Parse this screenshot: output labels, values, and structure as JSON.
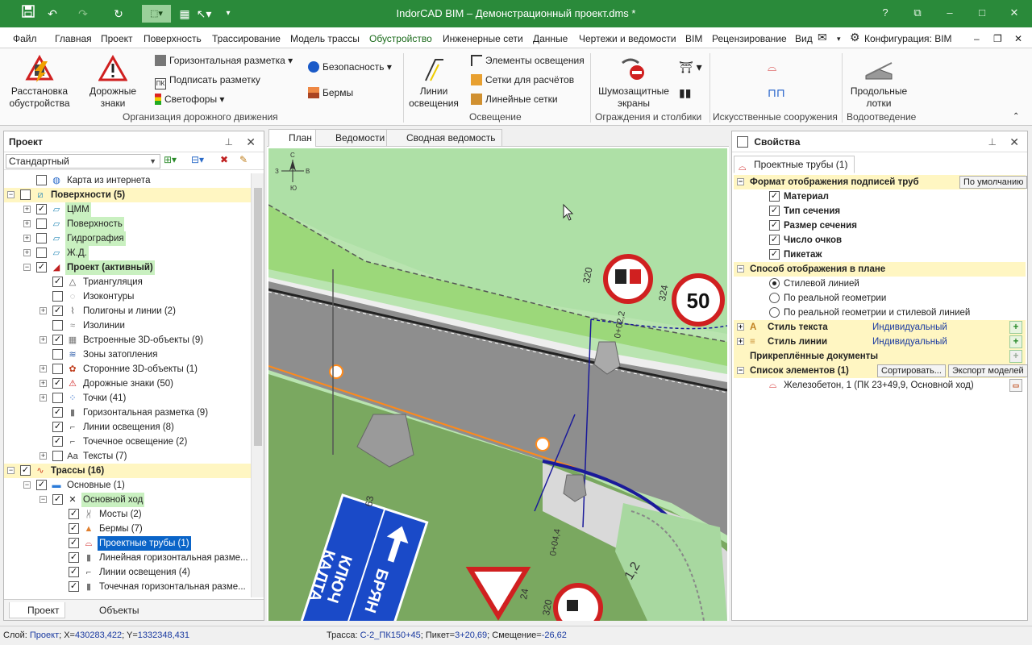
{
  "window": {
    "title": "IndorCAD BIM – Демонстрационный проект.dms *"
  },
  "menu": {
    "items": [
      "Файл",
      "Главная",
      "Проект",
      "Поверхность",
      "Трассирование",
      "Модель трассы",
      "Обустройство",
      "Инженерные сети",
      "Данные",
      "Чертежи и ведомости",
      "BIM",
      "Рецензирование",
      "Вид"
    ],
    "active": "Обустройство",
    "config_label": "Конфигурация: BIM"
  },
  "ribbon": {
    "placement_label": "Расстановка обустройства",
    "road_signs_label": "Дорожные знаки",
    "horizontal_marking": "Горизонтальная разметка",
    "sign_marking": "Подписать разметку",
    "traffic_lights": "Светофоры",
    "safety": "Безопасность",
    "berms": "Бермы",
    "group_traffic": "Организация дорожного движения",
    "lighting_lines": "Линии освещения",
    "lighting_elements": "Элементы освещения",
    "calc_grids": "Сетки для расчётов",
    "linear_grids": "Линейные сетки",
    "group_lighting": "Освещение",
    "noise_screens": "Шумозащитные экраны",
    "group_fences": "Ограждения и столбики",
    "group_structures": "Искусственные сооружения",
    "longitudinal_trays": "Продольные лотки",
    "group_drainage": "Водоотведение"
  },
  "left_panel": {
    "title": "Проект",
    "filter_value": "Стандартный",
    "tree": [
      {
        "label": "Карта из интернета",
        "level": 1,
        "check": "off",
        "tog": "",
        "icon": "globe-icon",
        "style": ""
      },
      {
        "label": "Поверхности (5)",
        "level": 0,
        "check": "off",
        "tog": "-",
        "icon": "surfaces-icon",
        "style": "bold yellow"
      },
      {
        "label": "ЦММ",
        "level": 1,
        "check": "on",
        "tog": "+",
        "icon": "surface-icon",
        "style": "green"
      },
      {
        "label": "Поверхность",
        "level": 1,
        "check": "off",
        "tog": "+",
        "icon": "surface-icon",
        "style": "green"
      },
      {
        "label": "Гидрография",
        "level": 1,
        "check": "off",
        "tog": "+",
        "icon": "surface-icon",
        "style": "green"
      },
      {
        "label": "Ж.Д.",
        "level": 1,
        "check": "off",
        "tog": "+",
        "icon": "surface-icon",
        "style": "green"
      },
      {
        "label": "Проект (активный)",
        "level": 1,
        "check": "on",
        "tog": "-",
        "icon": "surface-active-icon",
        "style": "bold green"
      },
      {
        "label": "Триангуляция",
        "level": 2,
        "check": "on",
        "tog": "",
        "icon": "triangulation-icon",
        "style": ""
      },
      {
        "label": "Изоконтуры",
        "level": 2,
        "check": "off",
        "tog": "",
        "icon": "isocontour-icon",
        "style": ""
      },
      {
        "label": "Полигоны и линии (2)",
        "level": 2,
        "check": "on",
        "tog": "+",
        "icon": "polygon-icon",
        "style": ""
      },
      {
        "label": "Изолинии",
        "level": 2,
        "check": "off",
        "tog": "",
        "icon": "isoline-icon",
        "style": ""
      },
      {
        "label": "Встроенные 3D-объекты (9)",
        "level": 2,
        "check": "on",
        "tog": "+",
        "icon": "object3d-icon",
        "style": ""
      },
      {
        "label": "Зоны затопления",
        "level": 2,
        "check": "off",
        "tog": "",
        "icon": "flood-icon",
        "style": ""
      },
      {
        "label": "Сторонние 3D-объекты (1)",
        "level": 2,
        "check": "off",
        "tog": "+",
        "icon": "external3d-icon",
        "style": ""
      },
      {
        "label": "Дорожные знаки (50)",
        "level": 2,
        "check": "on",
        "tog": "+",
        "icon": "road-sign-icon",
        "style": ""
      },
      {
        "label": "Точки (41)",
        "level": 2,
        "check": "off",
        "tog": "+",
        "icon": "points-icon",
        "style": ""
      },
      {
        "label": "Горизонтальная разметка (9)",
        "level": 2,
        "check": "on",
        "tog": "",
        "icon": "marking-icon",
        "style": ""
      },
      {
        "label": "Линии освещения (8)",
        "level": 2,
        "check": "on",
        "tog": "",
        "icon": "lighting-icon",
        "style": ""
      },
      {
        "label": "Точечное освещение (2)",
        "level": 2,
        "check": "on",
        "tog": "",
        "icon": "spot-light-icon",
        "style": ""
      },
      {
        "label": "Тексты (7)",
        "level": 2,
        "check": "off",
        "tog": "+",
        "icon": "text-icon",
        "style": ""
      },
      {
        "label": "Трассы (16)",
        "level": 0,
        "check": "on",
        "tog": "-",
        "icon": "routes-icon",
        "style": "bold yellow"
      },
      {
        "label": "Основные (1)",
        "level": 1,
        "check": "on",
        "tog": "-",
        "icon": "folder-icon",
        "style": ""
      },
      {
        "label": "Основной ход",
        "level": 2,
        "check": "on",
        "tog": "-",
        "icon": "main-route-icon",
        "style": "green"
      },
      {
        "label": "Мосты (2)",
        "level": 3,
        "check": "on",
        "tog": "",
        "icon": "bridge-icon",
        "style": ""
      },
      {
        "label": "Бермы (7)",
        "level": 3,
        "check": "on",
        "tog": "",
        "icon": "berm-icon",
        "style": ""
      },
      {
        "label": "Проектные трубы (1)",
        "level": 3,
        "check": "on",
        "tog": "",
        "icon": "pipe-icon",
        "style": "selected"
      },
      {
        "label": "Линейная горизонтальная разме...",
        "level": 3,
        "check": "on",
        "tog": "",
        "icon": "linear-marking-icon",
        "style": ""
      },
      {
        "label": "Линии освещения (4)",
        "level": 3,
        "check": "on",
        "tog": "",
        "icon": "lighting-icon",
        "style": ""
      },
      {
        "label": "Точечная горизонтальная разме...",
        "level": 3,
        "check": "on",
        "tog": "",
        "icon": "point-marking-icon",
        "style": ""
      }
    ],
    "tabs": [
      "Проект",
      "Объекты"
    ]
  },
  "center": {
    "tabs": [
      "План",
      "Ведомости",
      "Сводная ведомость"
    ],
    "compass": {
      "n": "С",
      "s": "Ю",
      "w": "З",
      "e": "В"
    },
    "sign_speed": "50",
    "big_sign_line1": "БРЯН",
    "big_sign_line2": "КЛЮЧ",
    "big_sign_line3": "КАЛТА",
    "pk_labels": [
      "320",
      "324",
      "0+02,2",
      "0+04,4",
      "320",
      "24",
      "63",
      "1,2"
    ]
  },
  "right_panel": {
    "title": "Свойства",
    "tab": "Проектные трубы (1)",
    "cat_format": "Формат отображения подписей труб",
    "btn_default": "По умолчанию",
    "format_items": [
      "Материал",
      "Тип сечения",
      "Размер сечения",
      "Число очков",
      "Пикетаж"
    ],
    "cat_display": "Способ отображения в плане",
    "display_items": [
      "Стилевой линией",
      "По реальной геометрии",
      "По реальной геометрии и стилевой линией"
    ],
    "text_style_label": "Стиль текста",
    "text_style_value": "Индивидуальный",
    "line_style_label": "Стиль линии",
    "line_style_value": "Индивидуальный",
    "attached_docs": "Прикреплённые документы",
    "elements_list": "Список элементов (1)",
    "btn_sort": "Сортировать...",
    "btn_export": "Экспорт моделей",
    "element_item": "Железобетон, 1 (ПК 23+49,9, Основной ход)"
  },
  "status": {
    "layer_label": "Слой:",
    "layer_value": "Проект",
    "x_label": "; X=",
    "x_value": "430283,422",
    "y_label": "; Y=",
    "y_value": "1332348,431",
    "route_label": "Трасса:",
    "route_value": "С-2_ПК150+45",
    "picket_label": "; Пикет=",
    "picket_value": "3+20,69",
    "offset_label": "; Смещение=",
    "offset_value": "-26,62"
  }
}
